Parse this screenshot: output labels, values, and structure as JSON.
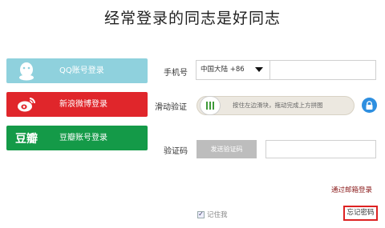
{
  "title": "经常登录的同志是好同志",
  "social": {
    "qq_label": "QQ账号登录",
    "weibo_label": "新浪微博登录",
    "douban_label": "豆瓣账号登录",
    "douban_icon_text": "豆瓣"
  },
  "form": {
    "phone_label": "手机号",
    "country_value": "中国大陆 +86",
    "phone_value": "",
    "slide_label": "滑动验证",
    "slide_hint": "按住左边滑块，拖动完成上方拼图",
    "code_label": "验证码",
    "send_code_label": "发送验证码",
    "code_value": ""
  },
  "email_login_link": "通过邮箱登录",
  "remember_label": "记住我",
  "remember_checked": true,
  "forgot_label": "忘记密码",
  "colors": {
    "qq": "#8fd1dd",
    "weibo": "#e0262b",
    "douban": "#149a48",
    "slider_handle_bars": "#3f9b3a",
    "lock": "#2e8fe0",
    "forgot_border": "#d22222"
  },
  "icons": {
    "qq": "qq-penguin-icon",
    "weibo": "weibo-eye-icon",
    "douban": "douban-text-logo",
    "slider": "grip-bars-icon",
    "lock": "lock-icon",
    "dropdown": "caret-down-icon",
    "checkbox": "checkbox-checked-icon"
  }
}
